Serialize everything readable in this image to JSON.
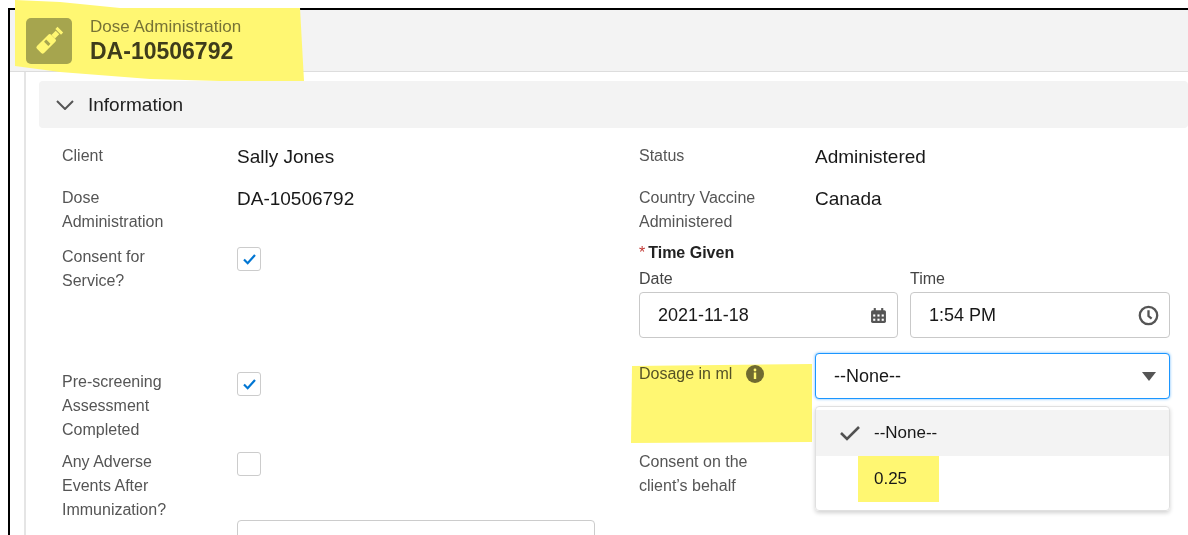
{
  "header": {
    "object_type": "Dose Administration",
    "record_name": "DA-10506792"
  },
  "section": {
    "title": "Information",
    "expanded": true
  },
  "left_fields": [
    {
      "kind": "text",
      "label": "Client",
      "value": "Sally Jones"
    },
    {
      "kind": "text",
      "label": "Dose Administration",
      "value": "DA-10506792"
    },
    {
      "kind": "checkbox",
      "label": "Consent for Service?",
      "checked": true
    },
    {
      "kind": "checkbox",
      "label": "Pre-screening Assessment Completed",
      "checked": true
    },
    {
      "kind": "checkbox",
      "label": "Any Adverse Events After Immunization?",
      "checked": false
    },
    {
      "kind": "input"
    }
  ],
  "right_fields": [
    {
      "kind": "text",
      "label": "Status",
      "value": "Administered"
    },
    {
      "kind": "text",
      "label": "Country Vaccine Administered",
      "value": "Canada"
    },
    {
      "kind": "datetime",
      "label": "Time Given",
      "required_mark": "*",
      "date_label": "Date",
      "date_value": "2021-11-18",
      "time_label": "Time",
      "time_value": "1:54 PM"
    },
    {
      "kind": "picklist",
      "label": "Dosage in ml",
      "value": "--None--",
      "open": true,
      "options": [
        {
          "label": "--None--",
          "selected": true
        },
        {
          "label": "0.25",
          "selected": false
        }
      ]
    },
    {
      "kind": "text",
      "label": "Consent on the client’s behalf"
    }
  ]
}
